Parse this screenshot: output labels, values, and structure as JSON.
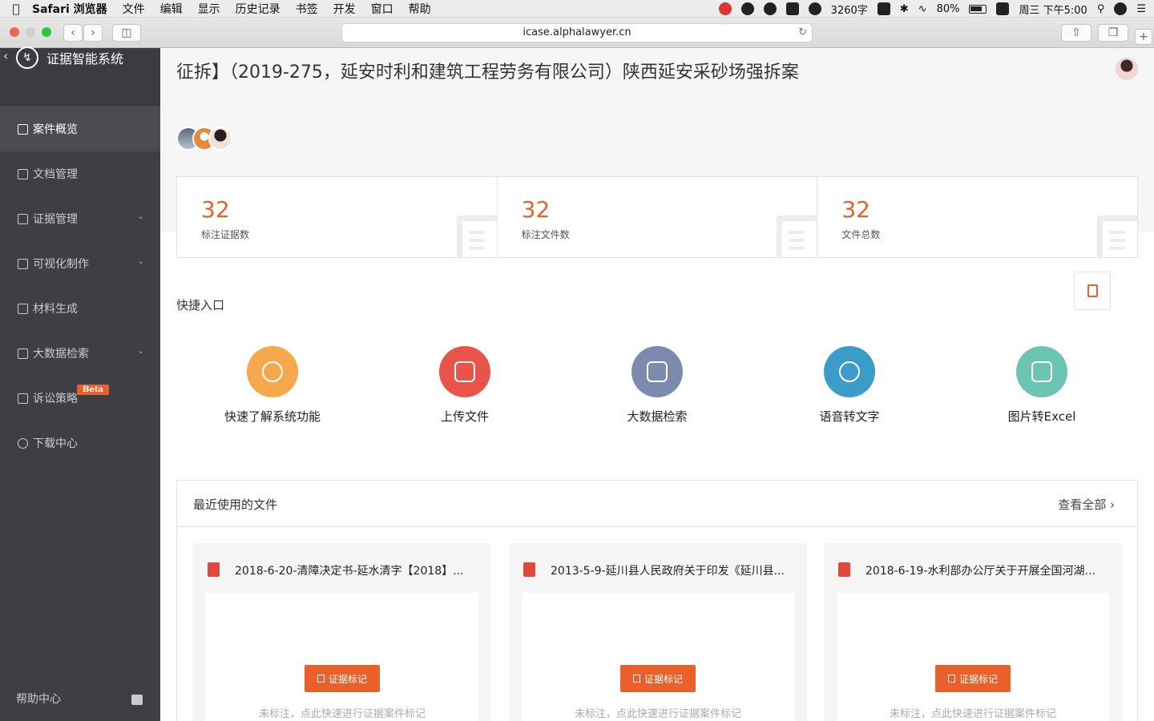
{
  "menubar": {
    "app": "Safari 浏览器",
    "items": [
      "文件",
      "编辑",
      "显示",
      "历史记录",
      "书签",
      "开发",
      "窗口",
      "帮助"
    ],
    "wordcount": "3260字",
    "battery": "80%",
    "datetime": "周三 下午5:00"
  },
  "browser": {
    "url": "icase.alphalawyer.cn"
  },
  "sidebar": {
    "brand": "证据智能系统",
    "items": [
      {
        "label": "案件概览"
      },
      {
        "label": "文档管理"
      },
      {
        "label": "证据管理"
      },
      {
        "label": "可视化制作"
      },
      {
        "label": "材料生成"
      },
      {
        "label": "大数据检索"
      },
      {
        "label": "诉讼策略",
        "badge": "Beta"
      },
      {
        "label": "下载中心"
      }
    ],
    "help": "帮助中心"
  },
  "case": {
    "title": "征拆】（2019-275，延安时利和建筑工程劳务有限公司）陕西延安采砂场强拆案"
  },
  "stats": [
    {
      "value": "32",
      "label": "标注证据数"
    },
    {
      "value": "32",
      "label": "标注文件数"
    },
    {
      "value": "32",
      "label": "文件总数"
    }
  ],
  "quick": {
    "title": "快捷入口",
    "items": [
      {
        "label": "快速了解系统功能",
        "color": "#f5a94c"
      },
      {
        "label": "上传文件",
        "color": "#e8534a"
      },
      {
        "label": "大数据检索",
        "color": "#7b8aad"
      },
      {
        "label": "语音转文字",
        "color": "#3b9bc9"
      },
      {
        "label": "图片转Excel",
        "color": "#6cc4b2"
      }
    ]
  },
  "recent": {
    "title": "最近使用的文件",
    "view_all": "查看全部",
    "files": [
      {
        "name": "2018-6-20-清障决定书-延水清字【2018】...",
        "button": "证据标记",
        "hint": "未标注，点此快速进行证据案件标记"
      },
      {
        "name": "2013-5-9-延川县人民政府关于印发《延川县...",
        "button": "证据标记",
        "hint": "未标注，点此快速进行证据案件标记"
      },
      {
        "name": "2018-6-19-水利部办公厅关于开展全国河湖...",
        "button": "证据标记",
        "hint": "未标注，点此快速进行证据案件标记"
      }
    ]
  },
  "colors": {
    "accent": "#e9602a",
    "sidebar": "#3d3f44"
  }
}
